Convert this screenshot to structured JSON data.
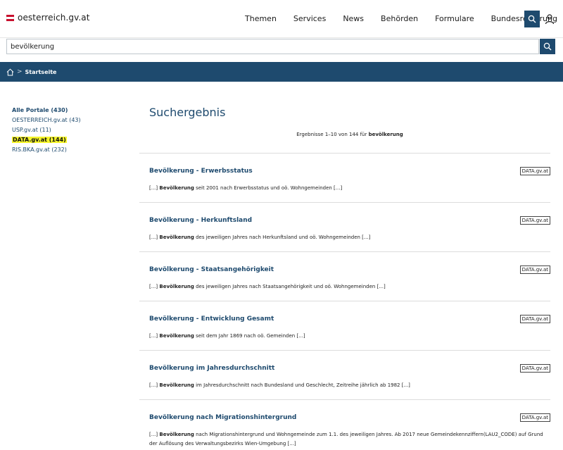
{
  "header": {
    "logo_text": "oesterreich.gv.at",
    "nav": [
      "Themen",
      "Services",
      "News",
      "Behörden",
      "Formulare",
      "Bundesregierung"
    ]
  },
  "search": {
    "value": "bevölkerung"
  },
  "breadcrumb": {
    "label": "Startseite"
  },
  "sidebar": {
    "items": [
      {
        "label": "Alle Portale (430)"
      },
      {
        "label": "OESTERREICH.gv.at (43)"
      },
      {
        "label": "USP.gv.at (11)"
      },
      {
        "label": "DATA.gv.at (144)"
      },
      {
        "label": "RIS.BKA.gv.at (232)"
      }
    ]
  },
  "main": {
    "title": "Suchergebnis",
    "summary_prefix": "Ergebnisse 1–10 von 144 für ",
    "summary_term": "bevölkerung"
  },
  "results": [
    {
      "title": "Bevölkerung - Erwerbsstatus",
      "badge": "DATA.gv.at",
      "pre": "[...] ",
      "term": "Bevölkerung",
      "post": " seit 2001 nach Erwerbsstatus und oö. Wohngemeinden [...]"
    },
    {
      "title": "Bevölkerung - Herkunftsland",
      "badge": "DATA.gv.at",
      "pre": "[...] ",
      "term": "Bevölkerung",
      "post": " des jeweiligen Jahres nach Herkunftsland und oö. Wohngemeinden [...]"
    },
    {
      "title": "Bevölkerung - Staatsangehörigkeit",
      "badge": "DATA.gv.at",
      "pre": "[...] ",
      "term": "Bevölkerung",
      "post": " des jeweiligen Jahres nach Staatsangehörigkeit und oö. Wohngemeinden [...]"
    },
    {
      "title": "Bevölkerung - Entwicklung Gesamt",
      "badge": "DATA.gv.at",
      "pre": "[...] ",
      "term": "Bevölkerung",
      "post": " seit dem Jahr 1869 nach oö. Gemeinden [...]"
    },
    {
      "title": "Bevölkerung im Jahresdurchschnitt",
      "badge": "DATA.gv.at",
      "pre": "[...] ",
      "term": "Bevölkerung",
      "post": " im Jahresdurchschnitt nach Bundesland und Geschlecht, Zeitreihe jährlich ab 1982 [...]"
    },
    {
      "title": "Bevölkerung nach Migrationshintergrund",
      "badge": "DATA.gv.at",
      "pre": "[...] ",
      "term": "Bevölkerung",
      "post": " nach Migrationshintergrund und Wohngemeinde zum 1.1. des jeweiligen Jahres. Ab 2017 neue Gemeindekennziffern(LAU2_CODE) auf Grund der Auflösung des Verwaltungsbezirks Wien-Umgebung [...]"
    }
  ]
}
